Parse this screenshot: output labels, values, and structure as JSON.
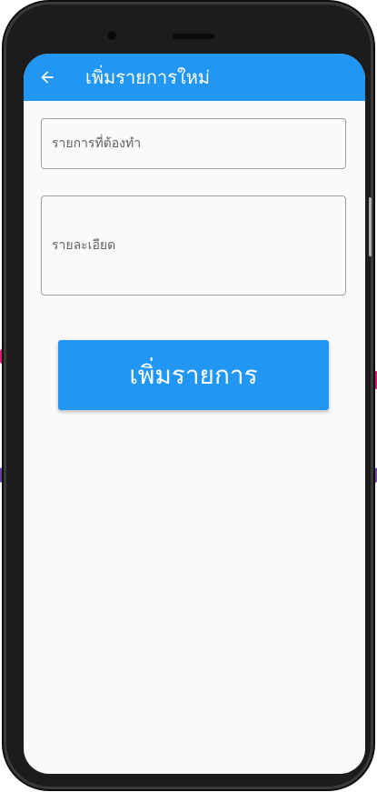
{
  "appbar": {
    "title": "เพิ่มรายการใหม่",
    "back_icon": "arrow-left-icon"
  },
  "form": {
    "title_placeholder": "รายการที่ต้องทำ",
    "title_value": "",
    "detail_placeholder": "รายละเอียด",
    "detail_value": "",
    "submit_label": "เพิ่มรายการ"
  },
  "colors": {
    "primary": "#2196f3",
    "background": "#fafafa",
    "border": "#9e9e9e"
  }
}
